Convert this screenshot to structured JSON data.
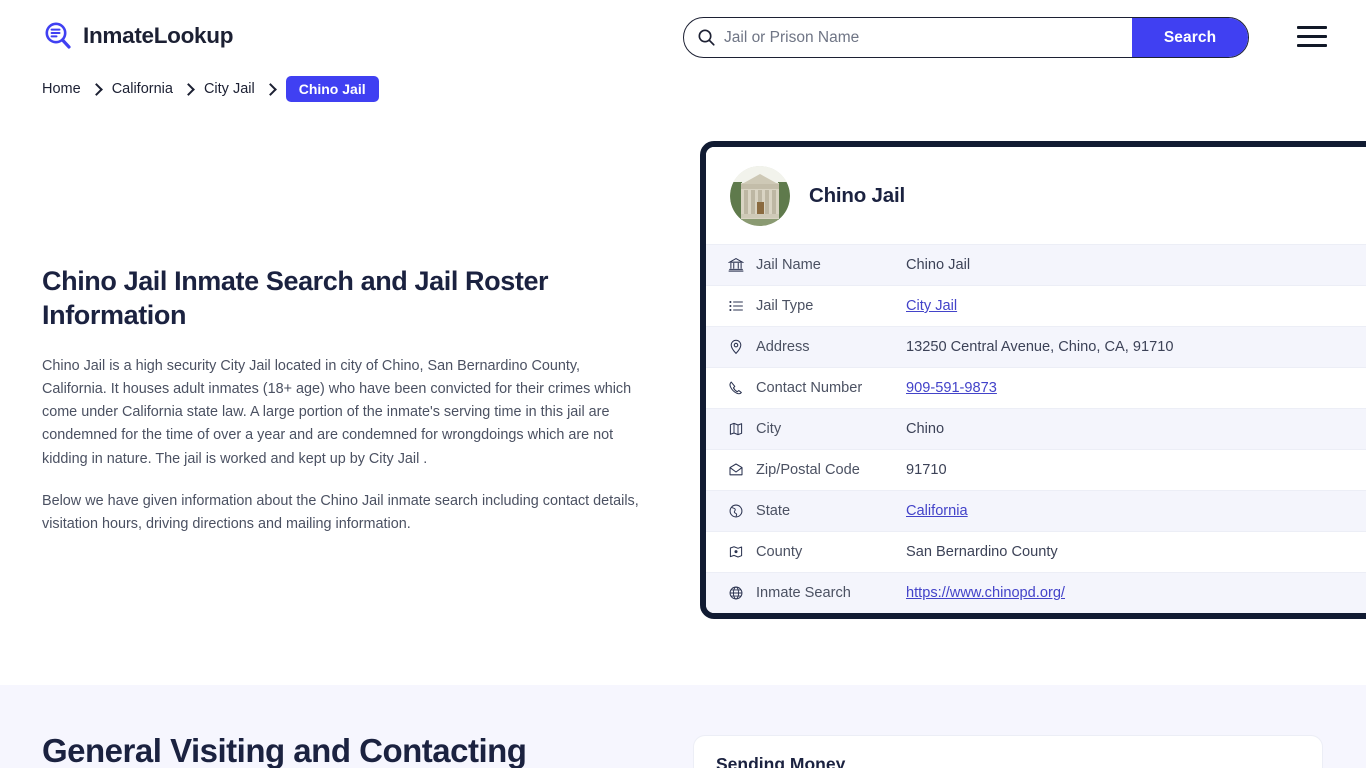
{
  "header": {
    "brand_name": "InmateLookup",
    "brand_icon": "search-list-logo-icon",
    "search": {
      "placeholder": "Jail or Prison Name",
      "value": "",
      "icon": "search-icon",
      "button_label": "Search"
    },
    "menu_icon": "hamburger-menu-icon"
  },
  "breadcrumb": {
    "items": [
      {
        "label": "Home",
        "current": false
      },
      {
        "label": "California",
        "current": false
      },
      {
        "label": "City Jail",
        "current": false
      },
      {
        "label": "Chino Jail",
        "current": true
      }
    ]
  },
  "article": {
    "heading": "Chino Jail Inmate Search and Jail Roster Information",
    "paragraph_1": "Chino Jail is a high security City Jail located in city of Chino, San Bernardino County, California. It houses adult inmates (18+ age) who have been convicted for their crimes which come under California state law. A large portion of the inmate's serving time in this jail are condemned for the time of over a year and are condemned for wrongdoings which are not kidding in nature. The jail is worked and kept up by City Jail .",
    "paragraph_2": "Below we have given information about the Chino Jail inmate search including contact details, visitation hours, driving directions and mailing information."
  },
  "info_card": {
    "thumbnail_alt": "chino-jail-building-photo",
    "title": "Chino Jail",
    "rows": [
      {
        "icon": "bank-icon",
        "label": "Jail Name",
        "value": "Chino Jail",
        "link": false
      },
      {
        "icon": "list-icon",
        "label": "Jail Type",
        "value": "City Jail",
        "link": true
      },
      {
        "icon": "map-pin-icon",
        "label": "Address",
        "value": "13250 Central Avenue, Chino, CA, 91710",
        "link": false
      },
      {
        "icon": "phone-icon",
        "label": "Contact Number",
        "value": "909-591-9873",
        "link": true
      },
      {
        "icon": "map-icon",
        "label": "City",
        "value": "Chino",
        "link": false
      },
      {
        "icon": "envelope-icon",
        "label": "Zip/Postal Code",
        "value": "91710",
        "link": false
      },
      {
        "icon": "globe-icon",
        "label": "State",
        "value": "California",
        "link": true
      },
      {
        "icon": "map-marked-icon",
        "label": "County",
        "value": "San Bernardino County",
        "link": false
      },
      {
        "icon": "globe-web-icon",
        "label": "Inmate Search",
        "value": "https://www.chinopd.org/",
        "link": true
      }
    ]
  },
  "lower_section": {
    "heading": "General Visiting and Contacting",
    "money_card_title": "Sending Money"
  },
  "colors": {
    "accent": "#4040f2",
    "card_border": "#111b32",
    "heading": "#1b2240",
    "link": "#4343c9",
    "row_alt_bg": "#f4f5fc",
    "lower_bg": "#f6f6fe"
  }
}
